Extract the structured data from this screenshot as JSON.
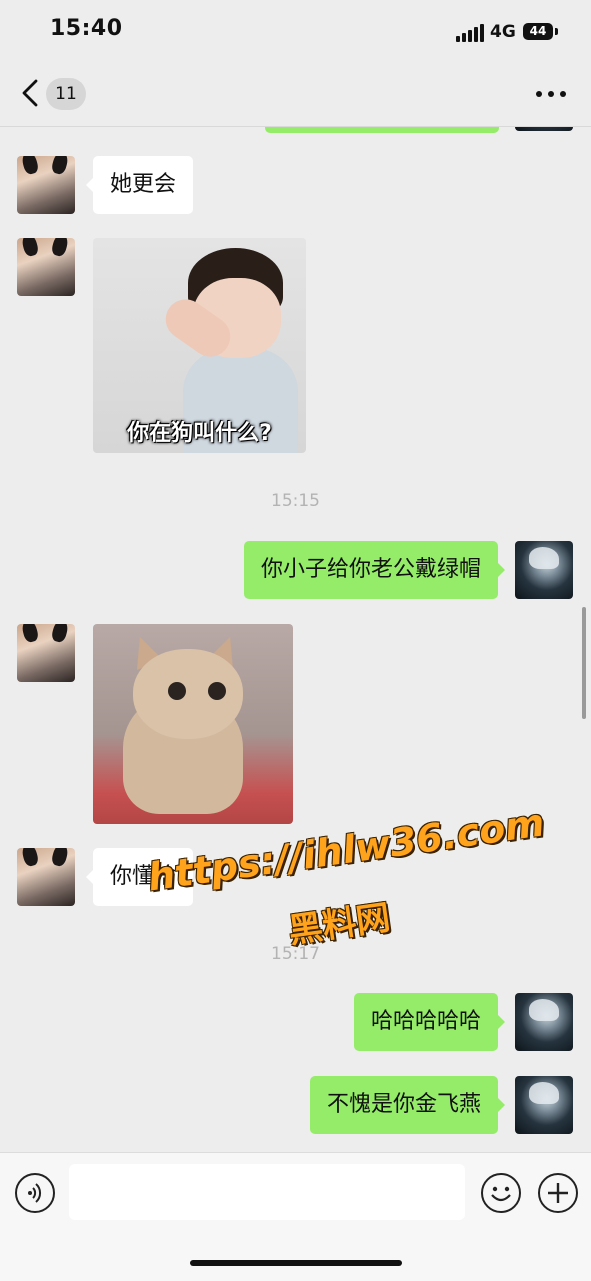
{
  "status_bar": {
    "time": "15:40",
    "network": "4G",
    "battery": "44"
  },
  "nav": {
    "unread_count": "11"
  },
  "messages": [
    {
      "side": "left",
      "text": "她更会"
    },
    {
      "side": "left",
      "image_caption": "你在狗叫什么?"
    },
    {
      "timestamp": "15:15"
    },
    {
      "side": "right",
      "text": "你小子给你老公戴绿帽"
    },
    {
      "side": "left",
      "image": "cat"
    },
    {
      "side": "left",
      "text": "你懂啥"
    },
    {
      "timestamp": "15:17"
    },
    {
      "side": "right",
      "text": "哈哈哈哈哈"
    },
    {
      "side": "right",
      "text": "不愧是你金飞燕"
    }
  ],
  "watermark": {
    "url": "https://ihlw36.com",
    "name": "黑料网"
  },
  "input": {
    "value": ""
  },
  "colors": {
    "background": "#ededed",
    "my_bubble": "#95ec69",
    "their_bubble": "#ffffff",
    "watermark": "#ffa21c"
  }
}
